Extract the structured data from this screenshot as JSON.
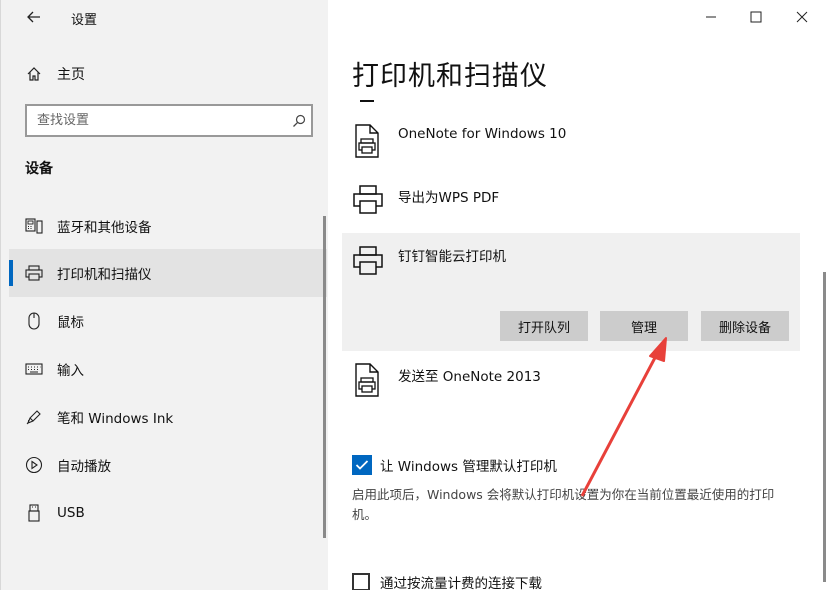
{
  "window": {
    "title": "设置",
    "controls": {
      "minimize": "minimize-icon",
      "maximize": "maximize-icon",
      "close": "close-icon"
    }
  },
  "sidebar": {
    "home_label": "主页",
    "search_placeholder": "查找设置",
    "section_title": "设备",
    "items": [
      {
        "label": "蓝牙和其他设备",
        "icon": "bluetooth-device-icon"
      },
      {
        "label": "打印机和扫描仪",
        "icon": "printer-icon",
        "active": true
      },
      {
        "label": "鼠标",
        "icon": "mouse-icon"
      },
      {
        "label": "输入",
        "icon": "keyboard-icon"
      },
      {
        "label": "笔和 Windows Ink",
        "icon": "pen-icon"
      },
      {
        "label": "自动播放",
        "icon": "autoplay-icon"
      },
      {
        "label": "USB",
        "icon": "usb-icon"
      }
    ]
  },
  "main": {
    "page_title": "打印机和扫描仪",
    "printers": [
      {
        "name": "OneNote for Windows 10"
      },
      {
        "name": "导出为WPS PDF"
      },
      {
        "name": "钉钉智能云打印机",
        "selected": true
      },
      {
        "name": "发送至 OneNote 2013"
      }
    ],
    "actions": {
      "open_queue": "打开队列",
      "manage": "管理",
      "remove_device": "删除设备"
    },
    "default_printer": {
      "checked": true,
      "label": "让 Windows 管理默认打印机",
      "description": "启用此项后，Windows 会将默认打印机设置为你在当前位置最近使用的打印机。"
    },
    "metered": {
      "checked": false,
      "label": "通过按流量计费的连接下载"
    }
  },
  "colors": {
    "accent": "#0067c0",
    "annotation_arrow": "#e8403a",
    "sidebar_bg": "#f2f2f2",
    "selected_bg": "#f0f0f0",
    "button_bg": "#cccccc"
  }
}
